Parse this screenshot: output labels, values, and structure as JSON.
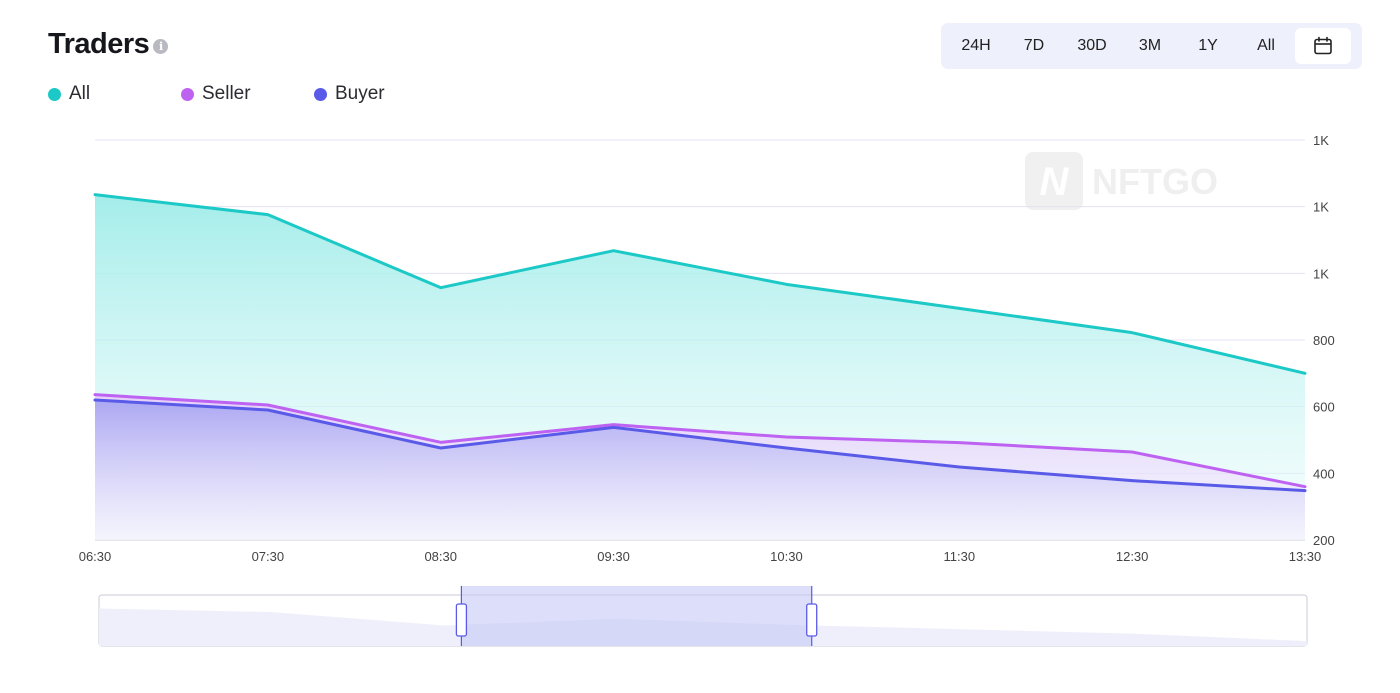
{
  "header": {
    "title": "Traders",
    "info_icon": "info-icon"
  },
  "legend": [
    {
      "label": "All",
      "color": "#1cc9c6"
    },
    {
      "label": "Seller",
      "color": "#be62f2"
    },
    {
      "label": "Buyer",
      "color": "#5a5ae8"
    }
  ],
  "time_range": {
    "options": [
      "24H",
      "7D",
      "30D",
      "3M",
      "1Y",
      "All"
    ],
    "calendar_icon": "calendar-icon"
  },
  "watermark": "NFTGO",
  "chart_data": {
    "type": "area",
    "x": [
      "06:30",
      "07:30",
      "08:30",
      "09:30",
      "10:30",
      "11:30",
      "12:30",
      "13:30"
    ],
    "y_tick_labels": [
      "200",
      "400",
      "600",
      "800",
      "1K",
      "1K",
      "1K"
    ],
    "ylim": [
      200,
      1400
    ],
    "y_ticks": [
      200,
      400,
      600,
      800,
      1000,
      1200,
      1400
    ],
    "grid": true,
    "legend_position": "top-left",
    "series": [
      {
        "name": "All",
        "color": "#1cc9c6",
        "values": [
          1236,
          1176,
          957,
          1068,
          967,
          895,
          822,
          700
        ]
      },
      {
        "name": "Seller",
        "color": "#be62f2",
        "values": [
          636,
          605,
          493,
          546,
          509,
          492,
          464,
          360
        ]
      },
      {
        "name": "Buyer",
        "color": "#5a5ae8",
        "values": [
          620,
          590,
          476,
          538,
          476,
          419,
          378,
          348
        ]
      }
    ],
    "navigator": {
      "selection_start_fraction": 0.3,
      "selection_end_fraction": 0.59
    }
  }
}
